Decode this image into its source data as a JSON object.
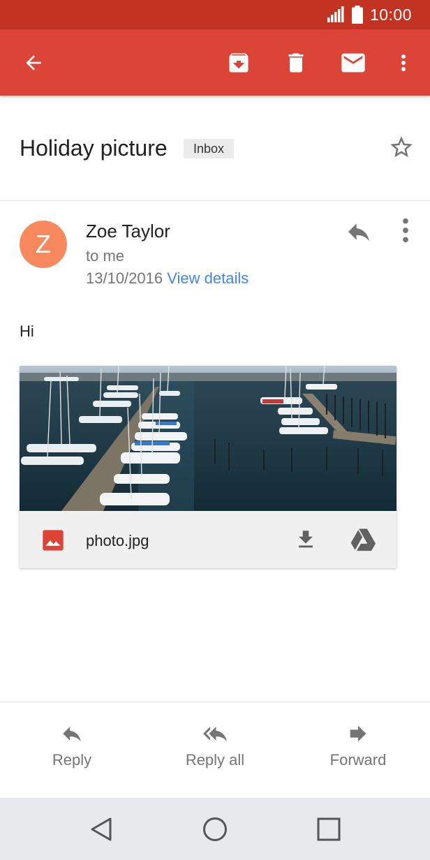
{
  "status_bar": {
    "time": "10:00"
  },
  "app_bar": {
    "back_icon": "arrow-left-icon",
    "archive_icon": "archive-icon",
    "delete_icon": "trash-icon",
    "mark_unread_icon": "envelope-icon",
    "more_icon": "more-vert-icon"
  },
  "email": {
    "subject": "Holiday picture",
    "label": "Inbox",
    "sender": "Zoe Taylor",
    "avatar_letter": "Z",
    "recipient": "to me",
    "date": "13/10/2016",
    "view_details": "View details",
    "body": "Hi",
    "attachment": {
      "file_name": "photo.jpg",
      "icon": "image-file-icon",
      "download_icon": "download-icon",
      "drive_icon": "google-drive-icon"
    }
  },
  "actions": [
    {
      "label": "Reply",
      "icon": "reply-icon"
    },
    {
      "label": "Reply all",
      "icon": "reply-all-icon"
    },
    {
      "label": "Forward",
      "icon": "forward-icon"
    }
  ],
  "colors": {
    "app_bar": "#db4437",
    "status_bar": "#c23321",
    "avatar": "#f8895f",
    "link": "#4285f4"
  }
}
